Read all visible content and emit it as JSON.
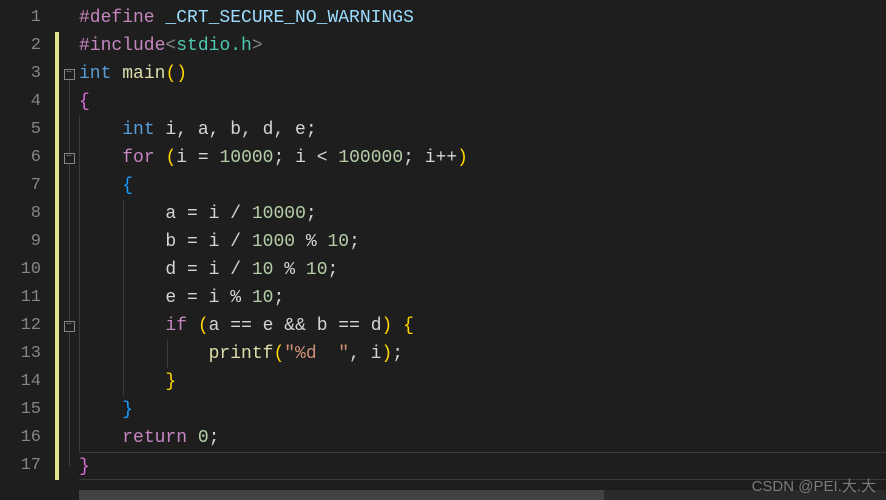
{
  "lines": [
    {
      "num": "1",
      "changed": false,
      "fold": ""
    },
    {
      "num": "2",
      "changed": true,
      "fold": ""
    },
    {
      "num": "3",
      "changed": true,
      "fold": "box"
    },
    {
      "num": "4",
      "changed": true,
      "fold": "line"
    },
    {
      "num": "5",
      "changed": true,
      "fold": "line"
    },
    {
      "num": "6",
      "changed": true,
      "fold": "box"
    },
    {
      "num": "7",
      "changed": true,
      "fold": "line"
    },
    {
      "num": "8",
      "changed": true,
      "fold": "line"
    },
    {
      "num": "9",
      "changed": true,
      "fold": "line"
    },
    {
      "num": "10",
      "changed": true,
      "fold": "line"
    },
    {
      "num": "11",
      "changed": true,
      "fold": "line"
    },
    {
      "num": "12",
      "changed": true,
      "fold": "box"
    },
    {
      "num": "13",
      "changed": true,
      "fold": "line"
    },
    {
      "num": "14",
      "changed": true,
      "fold": "line"
    },
    {
      "num": "15",
      "changed": true,
      "fold": "line"
    },
    {
      "num": "16",
      "changed": true,
      "fold": "line"
    },
    {
      "num": "17",
      "changed": true,
      "fold": "line"
    }
  ],
  "fold_symbol": "−",
  "code": {
    "l1": {
      "define": "#define",
      "macro": " _CRT_SECURE_NO_WARNINGS"
    },
    "l2": {
      "include": "#include",
      "open": "<",
      "header": "stdio.h",
      "close": ">"
    },
    "l3": {
      "type": "int",
      "sp": " ",
      "fn": "main",
      "paren": "()"
    },
    "l4": {
      "brace": "{"
    },
    "l5": {
      "indent": "    ",
      "type": "int",
      "vars": " i, a, b, d, e;"
    },
    "l6": {
      "indent": "    ",
      "kw": "for",
      "sp": " ",
      "po": "(",
      "v1": "i ",
      "eq": "= ",
      "n1": "10000",
      "sep1": "; ",
      "v2": "i ",
      "lt": "< ",
      "n2": "100000",
      "sep2": "; ",
      "v3": "i",
      "inc": "++",
      "pc": ")"
    },
    "l7": {
      "indent": "    ",
      "brace": "{"
    },
    "l8": {
      "indent": "        ",
      "v": "a ",
      "eq": "= ",
      "v2": "i ",
      "op": "/ ",
      "n": "10000",
      "semi": ";"
    },
    "l9": {
      "indent": "        ",
      "v": "b ",
      "eq": "= ",
      "v2": "i ",
      "op": "/ ",
      "n": "1000",
      "sp": " ",
      "op2": "% ",
      "n2": "10",
      "semi": ";"
    },
    "l10": {
      "indent": "        ",
      "v": "d ",
      "eq": "= ",
      "v2": "i ",
      "op": "/ ",
      "n": "10",
      "sp": " ",
      "op2": "% ",
      "n2": "10",
      "semi": ";"
    },
    "l11": {
      "indent": "        ",
      "v": "e ",
      "eq": "= ",
      "v2": "i ",
      "op": "% ",
      "n": "10",
      "semi": ";"
    },
    "l12": {
      "indent": "        ",
      "kw": "if",
      "sp": " ",
      "po": "(",
      "v1": "a ",
      "eq1": "== ",
      "v2": "e ",
      "and": "&& ",
      "v3": "b ",
      "eq2": "== ",
      "v4": "d",
      "pc": ")",
      "sp2": " ",
      "brace": "{"
    },
    "l13": {
      "indent": "            ",
      "fn": "printf",
      "po": "(",
      "str": "\"%d  \"",
      "comma": ", ",
      "v": "i",
      "pc": ")",
      "semi": ";"
    },
    "l14": {
      "indent": "        ",
      "brace": "}"
    },
    "l15": {
      "indent": "    ",
      "brace": "}"
    },
    "l16": {
      "indent": "    ",
      "kw": "return",
      "sp": " ",
      "n": "0",
      "semi": ";"
    },
    "l17": {
      "brace": "}"
    }
  },
  "watermark": "CSDN @PEI.大.大"
}
